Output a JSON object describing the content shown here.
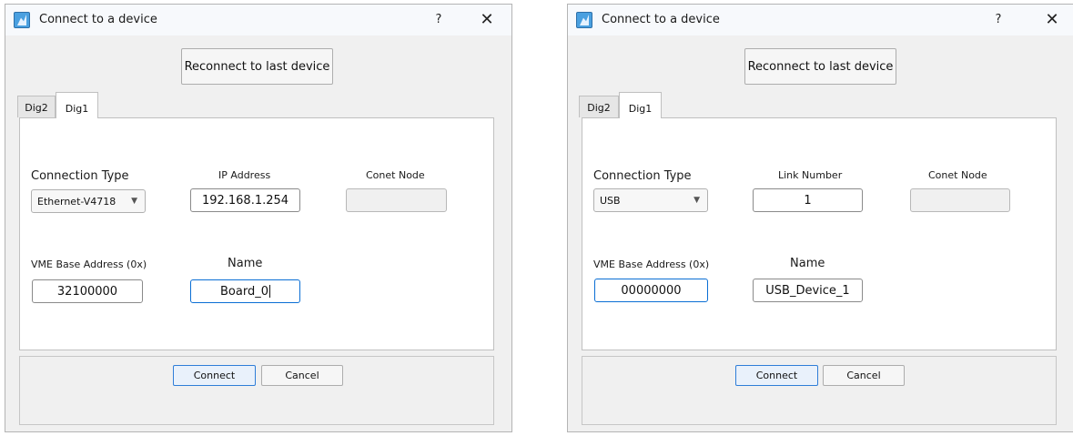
{
  "dialogs": [
    {
      "title": "Connect to a device",
      "help_label": "?",
      "close_label": "✕",
      "reconnect_label": "Reconnect to last device",
      "tabs": [
        {
          "label": "Dig2",
          "active": false
        },
        {
          "label": "Dig1",
          "active": true
        }
      ],
      "connection_type_label": "Connection Type",
      "connection_type_value": "Ethernet-V4718",
      "address_label": "IP Address",
      "address_value": "192.168.1.254",
      "conet_node_label": "Conet Node",
      "conet_node_value": "",
      "vme_base_label": "VME Base Address (0x)",
      "vme_base_value": "32100000",
      "name_label": "Name",
      "name_value": "Board_0",
      "focused_field": "name",
      "connect_label": "Connect",
      "cancel_label": "Cancel"
    },
    {
      "title": "Connect to a device",
      "help_label": "?",
      "close_label": "✕",
      "reconnect_label": "Reconnect to last device",
      "tabs": [
        {
          "label": "Dig2",
          "active": false
        },
        {
          "label": "Dig1",
          "active": true
        }
      ],
      "connection_type_label": "Connection Type",
      "connection_type_value": "USB",
      "address_label": "Link Number",
      "address_value": "1",
      "conet_node_label": "Conet Node",
      "conet_node_value": "",
      "vme_base_label": "VME Base Address (0x)",
      "vme_base_value": "00000000",
      "name_label": "Name",
      "name_value": "USB_Device_1",
      "focused_field": "vme_base",
      "connect_label": "Connect",
      "cancel_label": "Cancel"
    }
  ],
  "colors": {
    "dialog_bg": "#f0f0f0",
    "focus_border": "#0a6ed4",
    "default_button_border": "#2f7ed8"
  },
  "icons": [
    "app-icon",
    "help-icon",
    "close-icon",
    "chevron-down-icon"
  ]
}
